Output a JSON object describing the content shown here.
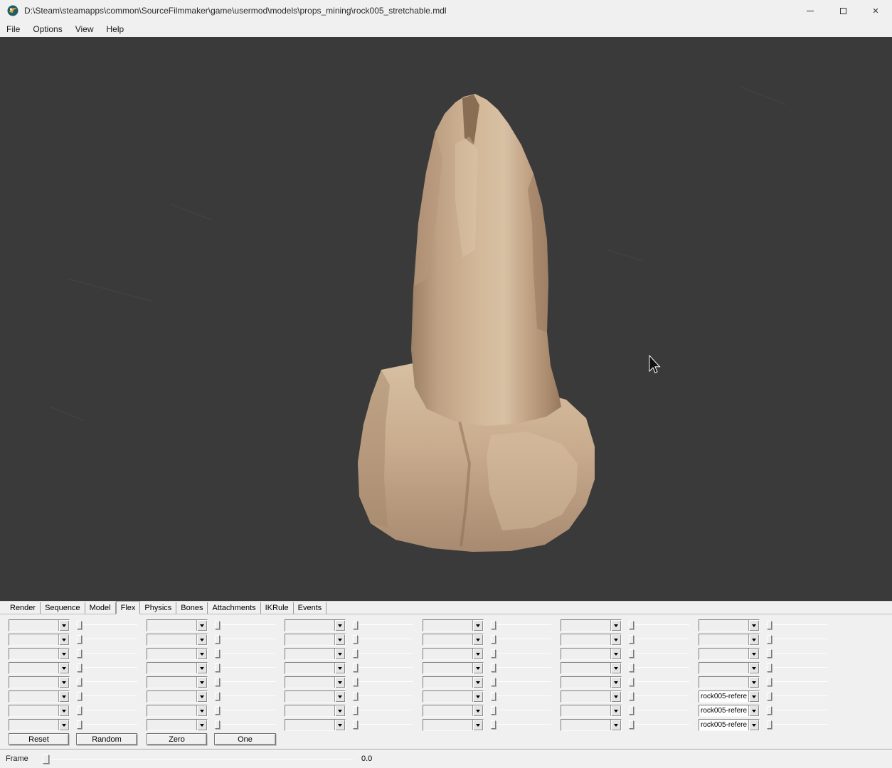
{
  "window": {
    "title": "D:\\Steam\\steamapps\\common\\SourceFilmmaker\\game\\usermod\\models\\props_mining\\rock005_stretchable.mdl",
    "app_icon": "hlmv-app-icon",
    "controls": {
      "minimize": "minimize-icon",
      "maximize": "maximize-icon",
      "close": "✕"
    }
  },
  "menu": {
    "items": [
      "File",
      "Options",
      "View",
      "Help"
    ]
  },
  "tabs": {
    "items": [
      "Render",
      "Sequence",
      "Model",
      "Flex",
      "Physics",
      "Bones",
      "Attachments",
      "IKRule",
      "Events"
    ],
    "active": "Flex"
  },
  "flex": {
    "groups": [
      {
        "combos": [
          "",
          "",
          "",
          "",
          "",
          "",
          "",
          ""
        ]
      },
      {
        "combos": [
          "",
          "",
          "",
          "",
          "",
          "",
          "",
          ""
        ]
      },
      {
        "combos": [
          "",
          "",
          "",
          "",
          "",
          "",
          "",
          ""
        ]
      },
      {
        "combos": [
          "",
          "",
          "",
          "",
          "",
          "",
          "",
          ""
        ]
      },
      {
        "combos": [
          "",
          "",
          "",
          "",
          "",
          "",
          "",
          ""
        ]
      },
      {
        "combos": [
          "",
          "",
          "",
          "",
          "",
          "rock005-refere",
          "rock005-refere",
          "rock005-refere"
        ]
      }
    ],
    "buttons": [
      "Reset",
      "Random",
      "Zero",
      "One"
    ],
    "slider_value": 0
  },
  "frame": {
    "label": "Frame",
    "value": "0.0"
  },
  "colors": {
    "viewport_bg": "#3a3a3b",
    "panel_bg": "#f0f0f0",
    "rock_light": "#d8c0a4",
    "rock_mid": "#c9ac8e",
    "rock_dark": "#a0826a"
  }
}
